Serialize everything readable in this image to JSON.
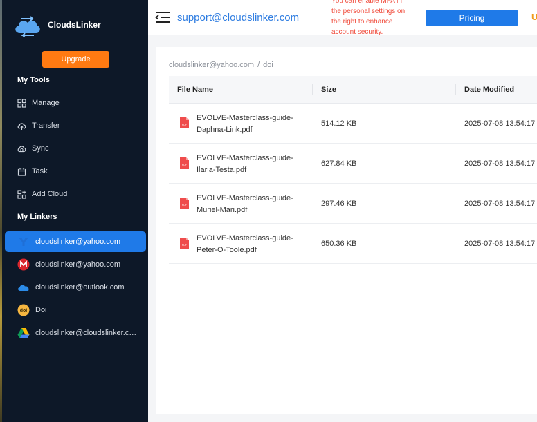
{
  "app": {
    "name": "CloudsLinker"
  },
  "sidebar": {
    "upgrade_label": "Upgrade",
    "my_tools_title": "My Tools",
    "tools": [
      {
        "label": "Manage",
        "icon": "grid-icon"
      },
      {
        "label": "Transfer",
        "icon": "cloud-upload-icon"
      },
      {
        "label": "Sync",
        "icon": "cloud-sync-icon"
      },
      {
        "label": "Task",
        "icon": "calendar-icon"
      },
      {
        "label": "Add Cloud",
        "icon": "add-grid-icon"
      }
    ],
    "my_linkers_title": "My Linkers",
    "linkers": [
      {
        "label": "cloudslinker@yahoo.com",
        "icon": "yahoo-icon",
        "active": true
      },
      {
        "label": "cloudslinker@yahoo.com",
        "icon": "mega-icon",
        "active": false
      },
      {
        "label": "cloudslinker@outlook.com",
        "icon": "onedrive-icon",
        "active": false
      },
      {
        "label": "Doi",
        "icon": "doi-icon",
        "active": false
      },
      {
        "label": "cloudslinker@cloudslinker.co...",
        "icon": "google-drive-icon",
        "active": false
      }
    ]
  },
  "header": {
    "account_email": "support@cloudslinker.com",
    "notice_line1": "You can enable MFA in",
    "notice_line2": "the personal settings on",
    "notice_line3": "the right to enhance",
    "notice_line4": "account security.",
    "pricing_label": "Pricing",
    "cut_text": "U"
  },
  "breadcrumb": {
    "root": "cloudslinker@yahoo.com",
    "separator": "/",
    "current": "doi"
  },
  "table": {
    "columns": [
      "File Name",
      "Size",
      "Date Modified"
    ],
    "rows": [
      {
        "name_line1": "EVOLVE-Masterclass-guide-",
        "name_line2": "Daphna-Link.pdf",
        "size": "514.12 KB",
        "date": "2025-07-08 13:54:17"
      },
      {
        "name_line1": "EVOLVE-Masterclass-guide-",
        "name_line2": "Ilaria-Testa.pdf",
        "size": "627.84 KB",
        "date": "2025-07-08 13:54:17"
      },
      {
        "name_line1": "EVOLVE-Masterclass-guide-",
        "name_line2": "Muriel-Mari.pdf",
        "size": "297.46 KB",
        "date": "2025-07-08 13:54:17"
      },
      {
        "name_line1": "EVOLVE-Masterclass-guide-",
        "name_line2": "Peter-O-Toole.pdf",
        "size": "650.36 KB",
        "date": "2025-07-08 13:54:17"
      }
    ]
  },
  "colors": {
    "sidebar_bg": "#0d1828",
    "accent_blue": "#1f7ae8",
    "upgrade_orange": "#ff7a12",
    "notice_red": "#f04a3a",
    "pdf_red": "#ef4c4c"
  }
}
